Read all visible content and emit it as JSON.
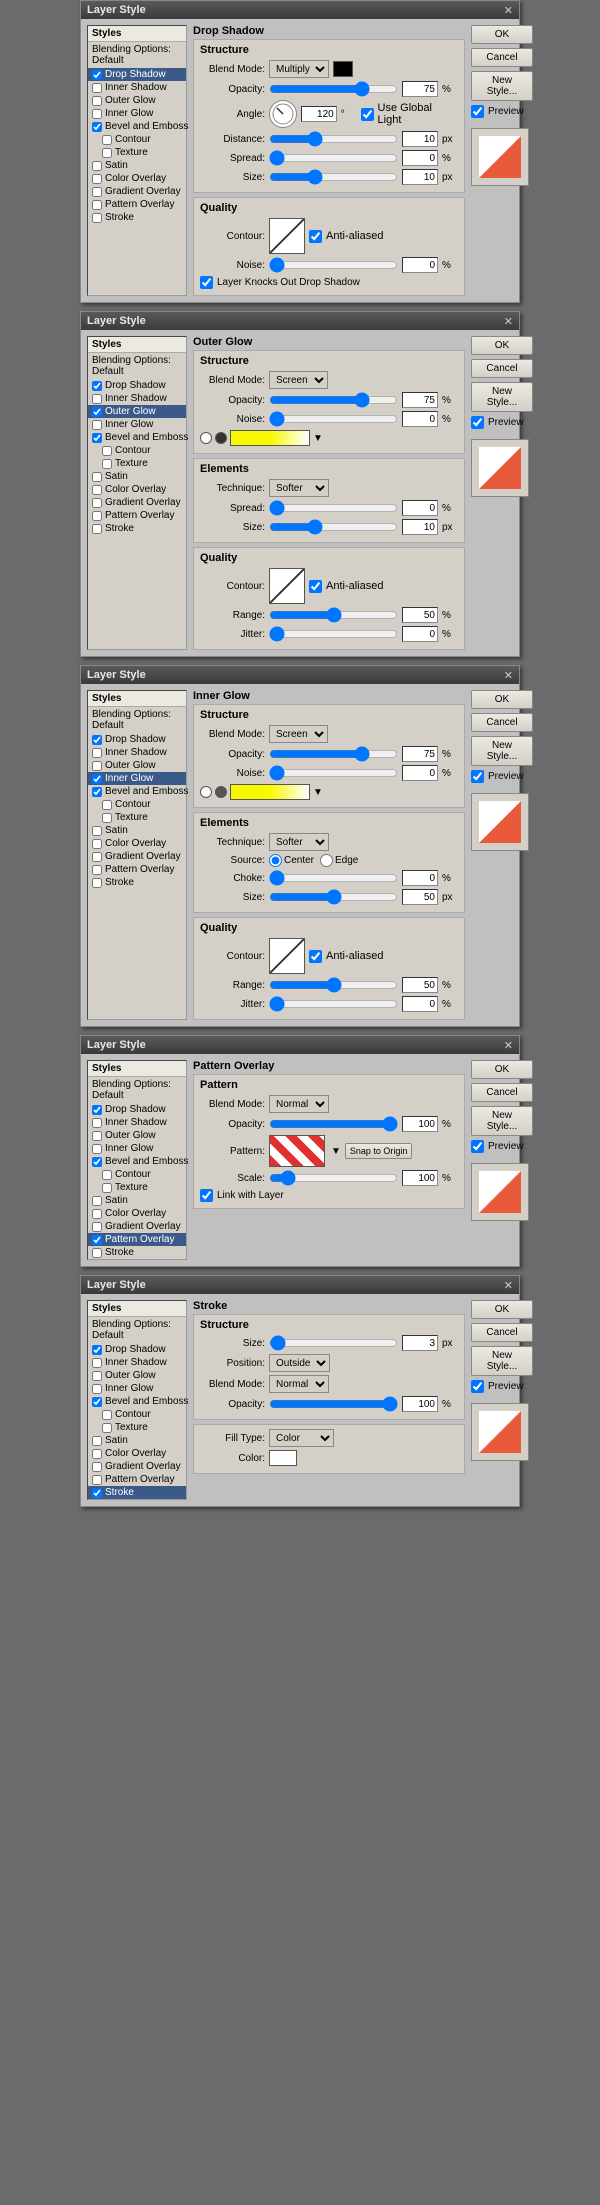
{
  "dialogs": [
    {
      "id": "drop-shadow",
      "title": "Layer Style",
      "activeItem": "Drop Shadow",
      "sectionTitle": "Drop Shadow",
      "structureTitle": "Structure",
      "blendMode": "Multiply",
      "opacity": "75",
      "angle": "120",
      "useGlobalLight": true,
      "distance": "10",
      "spread": "0",
      "size": "10",
      "qualityTitle": "Quality",
      "contourLabel": "Contour:",
      "antiAliased": true,
      "noiseVal": "0",
      "layerKnocks": true
    },
    {
      "id": "outer-glow",
      "title": "Layer Style",
      "activeItem": "Outer Glow",
      "sectionTitle": "Outer Glow",
      "structureTitle": "Structure",
      "blendMode": "Screen",
      "opacity": "75",
      "noise": "0",
      "technique": "Softer",
      "spread": "0",
      "size": "10",
      "qualityTitle": "Quality",
      "range": "50",
      "jitter": "0"
    },
    {
      "id": "inner-glow",
      "title": "Layer Style",
      "activeItem": "Inner Glow",
      "sectionTitle": "Inner Glow",
      "structureTitle": "Structure",
      "blendMode": "Screen",
      "opacity": "75",
      "noise": "0",
      "technique": "Softer",
      "source": "Center",
      "choke": "0",
      "size": "50",
      "qualityTitle": "Quality",
      "range": "50",
      "jitter": "0"
    },
    {
      "id": "pattern-overlay",
      "title": "Layer Style",
      "activeItem": "Pattern Overlay",
      "sectionTitle": "Pattern Overlay",
      "patternTitle": "Pattern",
      "blendMode": "Normal",
      "opacity": "100",
      "scale": "100",
      "linkWithLayer": true
    },
    {
      "id": "stroke",
      "title": "Layer Style",
      "activeItem": "Stroke",
      "sectionTitle": "Stroke",
      "structureTitle": "Structure",
      "size": "3",
      "position": "Outside",
      "blendMode": "Normal",
      "opacity": "100",
      "fillTypeLabel": "Fill Type:",
      "fillType": "Color",
      "colorLabel": "Color:"
    }
  ],
  "sidebar": {
    "stylesLabel": "Styles",
    "blendingLabel": "Blending Options: Default",
    "items": [
      "Drop Shadow",
      "Inner Shadow",
      "Outer Glow",
      "Inner Glow",
      "Bevel and Emboss",
      "Contour",
      "Texture",
      "Satin",
      "Color Overlay",
      "Gradient Overlay",
      "Pattern Overlay",
      "Stroke"
    ]
  },
  "buttons": {
    "ok": "OK",
    "cancel": "Cancel",
    "newStyle": "New Style...",
    "preview": "Preview"
  }
}
